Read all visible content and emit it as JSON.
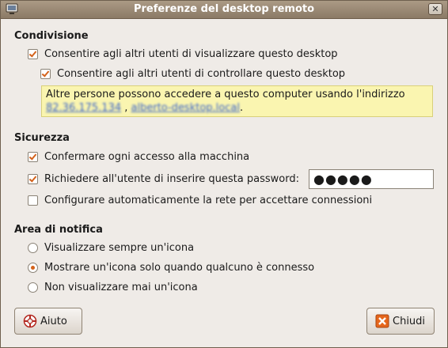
{
  "window": {
    "title": "Preferenze del desktop remoto"
  },
  "sharing": {
    "heading": "Condivisione",
    "allow_view": {
      "label": "Consentire agli altri utenti di visualizzare questo desktop",
      "checked": true
    },
    "allow_control": {
      "label": "Consentire agli altri utenti di controllare questo desktop",
      "checked": true
    },
    "info_text": "Altre persone possono accedere a questo computer usando l'indirizzo",
    "address_ip": "82.36.175.134",
    "separator": ",",
    "address_host": "alberto-desktop.local",
    "end": "."
  },
  "security": {
    "heading": "Sicurezza",
    "confirm_access": {
      "label": "Confermare ogni accesso alla macchina",
      "checked": true
    },
    "require_password": {
      "label": "Richiedere all'utente di inserire questa password:",
      "checked": true
    },
    "password_value": "●●●●●",
    "configure_network": {
      "label": "Configurare automaticamente la rete per accettare connessioni",
      "checked": false
    }
  },
  "notification": {
    "heading": "Area di notifica",
    "options": [
      {
        "label": "Visualizzare sempre un'icona",
        "selected": false
      },
      {
        "label": "Mostrare un'icona solo quando qualcuno è connesso",
        "selected": true
      },
      {
        "label": "Non visualizzare mai un'icona",
        "selected": false
      }
    ]
  },
  "buttons": {
    "help": "Aiuto",
    "close": "Chiudi"
  },
  "colors": {
    "accent": "#d4621b",
    "titlebar": "#9c8b76",
    "info_bg": "#faf5b0"
  }
}
